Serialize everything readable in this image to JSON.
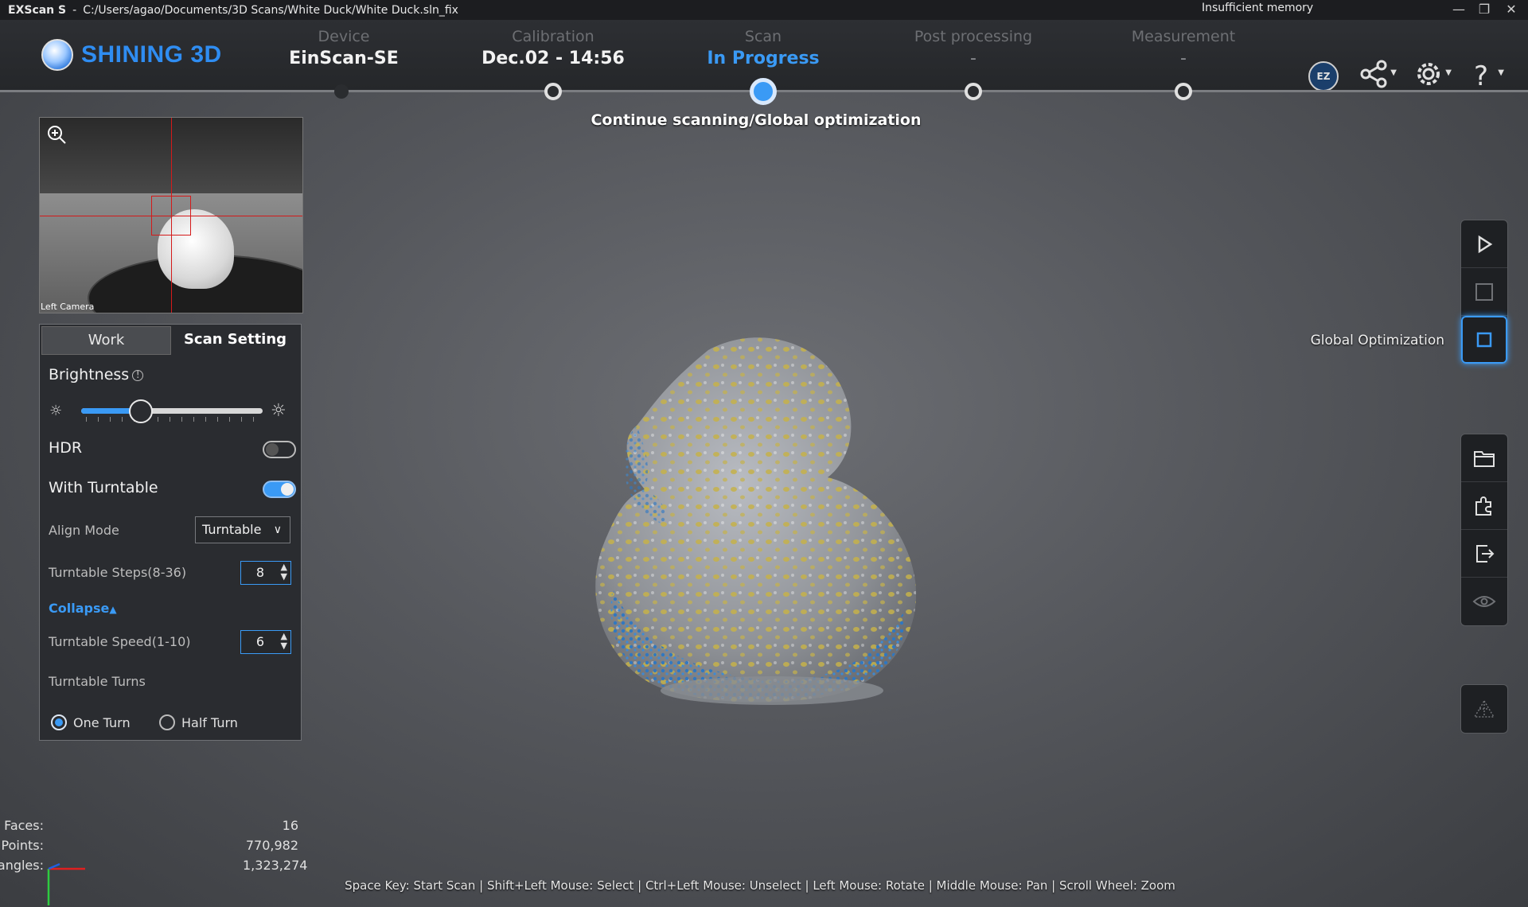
{
  "titlebar": {
    "app": "EXScan S",
    "separator": "-",
    "path": "C:/Users/agao/Documents/3D Scans/White Duck/White Duck.sln_fix",
    "memory_warning": "Insufficient memory",
    "minimize": "—",
    "restore": "❐",
    "close": "✕"
  },
  "header": {
    "brand": "SHINING 3D",
    "steps": [
      {
        "label": "Device",
        "value": "EinScan-SE"
      },
      {
        "label": "Calibration",
        "value": "Dec.02 - 14:56"
      },
      {
        "label": "Scan",
        "value": "In Progress"
      },
      {
        "label": "Post processing",
        "value": "-"
      },
      {
        "label": "Measurement",
        "value": "-"
      }
    ],
    "icons": [
      "ezmodel-icon",
      "share-icon",
      "settings-icon",
      "help-icon"
    ],
    "ez_text": "EZ"
  },
  "hint": "Continue scanning/Global optimization",
  "camera": {
    "label": "Left Camera"
  },
  "panel": {
    "tabs": [
      "Work",
      "Scan Setting"
    ],
    "brightness_label": "Brightness",
    "brightness_level": 0.33,
    "hdr_label": "HDR",
    "hdr_on": false,
    "turntable_label": "With Turntable",
    "turntable_on": true,
    "align_mode_label": "Align Mode",
    "align_mode_value": "Turntable",
    "steps_label": "Turntable Steps(8-36)",
    "steps_value": "8",
    "collapse_label": "Collapse",
    "speed_label": "Turntable Speed(1-10)",
    "speed_value": "6",
    "turns_label": "Turntable Turns",
    "turn_options": [
      "One Turn",
      "Half Turn"
    ],
    "turn_selected": "One Turn"
  },
  "right_toolbar": {
    "global_optimization_label": "Global Optimization",
    "buttons": [
      "play-icon",
      "stop-scan-icon",
      "global-optimization-icon",
      "open-folder-icon",
      "plugin-icon",
      "export-icon",
      "visibility-icon",
      "mesh-icon"
    ]
  },
  "stats": {
    "faces_label": "Faces:",
    "faces": "16",
    "points_label": "Points:",
    "points": "770,982",
    "triangles_label": "Triangles:",
    "triangles": "1,323,274"
  },
  "shortcuts": "Space Key: Start Scan | Shift+Left Mouse: Select | Ctrl+Left Mouse: Unselect | Left Mouse: Rotate | Middle Mouse: Pan | Scroll Wheel: Zoom",
  "colors": {
    "accent": "#3a9af5",
    "highlight": "#d9c24a",
    "background": "#55575c"
  }
}
